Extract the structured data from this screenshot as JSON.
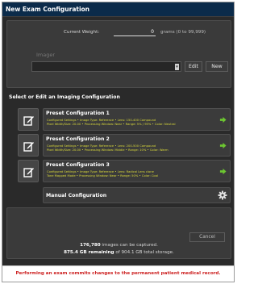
{
  "window": {
    "title": "New Exam Configuration"
  },
  "current_weight": {
    "label": "Current Weight:",
    "value": "0",
    "unit_hint": "grams (0 to 99,999)"
  },
  "imager": {
    "label": "Imager",
    "selected": "",
    "edit_label": "Edit",
    "new_label": "New"
  },
  "section_label": "Select or Edit an Imaging Configuration",
  "configs": [
    {
      "title": "Preset Configuration 1",
      "line1": "Configured Settings • Image Type: Reference • Lens: 150-400 Compound",
      "line2": "Pixel Width/Size: 20.00 • Processing Window: Near • Range: 5% / 95% • Color: Neutral"
    },
    {
      "title": "Preset Configuration 2",
      "line1": "Configured Settings • Image Type: Reference • Lens: 200-500 Compound",
      "line2": "Pixel Width/Size: 20.00 • Processing Window: Middle • Range: 10% • Color: Warm"
    },
    {
      "title": "Preset Configuration 3",
      "line1": "Configured Settings • Image Type: Reference • Lens: Radical Lens clone",
      "line2": "Tone Mapped Mode • Processing Window: Near • Range: 50% • Color: Cool"
    }
  ],
  "manual": {
    "title": "Manual Configuration"
  },
  "summary": {
    "images_count": "176,780",
    "images_text": "images can be captured.",
    "gb_remaining": "875.4 GB remaining",
    "gb_total_text": "of 904.1 GB total storage."
  },
  "cancel_label": "Cancel",
  "footer_warning": "Performing an exam commits changes to the permanent patient medical record.",
  "colors": {
    "title_bar": "#0b2b4a",
    "detail_text": "#d8d83a",
    "arrow_green": "#6cc631",
    "warning_red": "#cc1e1e"
  },
  "icons": {
    "edit": "edit-pencil-icon",
    "arrow": "green-arrow-right-icon",
    "gear": "gear-icon"
  }
}
